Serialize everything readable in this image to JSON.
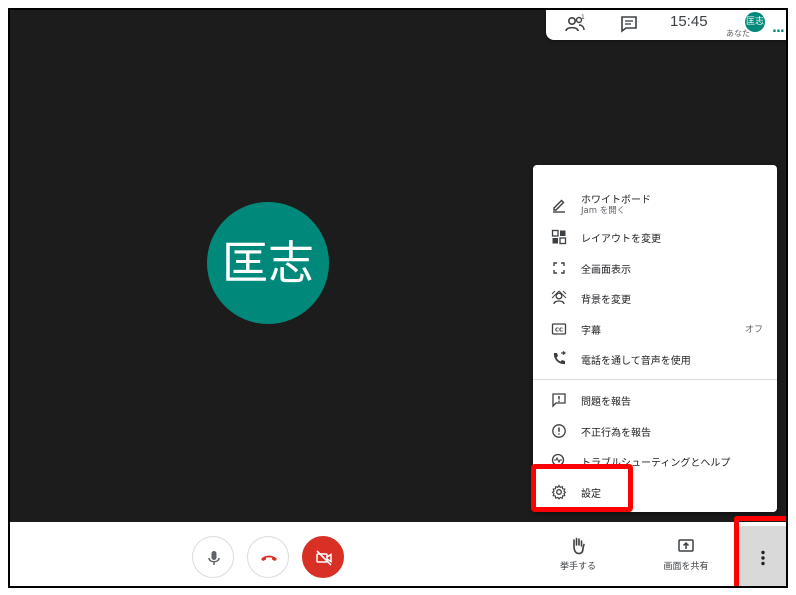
{
  "topbar": {
    "time": "15:45",
    "self_avatar_initials": "匡志",
    "self_label": "あなた",
    "more_dots": "..."
  },
  "main": {
    "participant_initials": "匡志"
  },
  "menu": {
    "items": [
      {
        "label": "ホワイトボード",
        "sub": "Jam を開く",
        "icon": "pencil-icon"
      },
      {
        "label": "レイアウトを変更",
        "icon": "layout-icon"
      },
      {
        "label": "全画面表示",
        "icon": "fullscreen-icon"
      },
      {
        "label": "背景を変更",
        "icon": "background-icon"
      },
      {
        "label": "字幕",
        "value": "オフ",
        "icon": "captions-icon"
      },
      {
        "label": "電話を通して音声を使用",
        "icon": "phone-icon"
      },
      {
        "label": "問題を報告",
        "icon": "report-problem-icon"
      },
      {
        "label": "不正行為を報告",
        "icon": "report-abuse-icon"
      },
      {
        "label": "トラブルシューティングとヘルプ",
        "icon": "troubleshoot-icon"
      },
      {
        "label": "設定",
        "icon": "gear-icon"
      }
    ]
  },
  "bottombar": {
    "raise_hand_label": "挙手する",
    "present_label": "画面を共有"
  },
  "colors": {
    "accent": "#00897b",
    "hangup": "#d93025",
    "highlight": "#ff0000",
    "stage": "#1c1c1c"
  }
}
